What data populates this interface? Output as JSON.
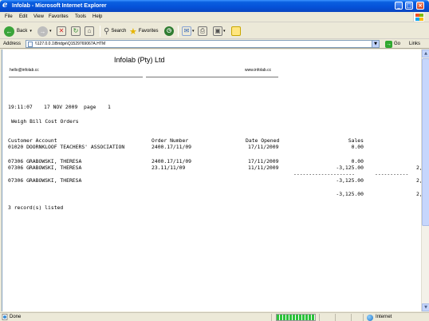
{
  "window": {
    "title": "Infolab - Microsoft Internet Explorer",
    "icon": "ie-icon",
    "controls": [
      "minimize",
      "maximize",
      "close"
    ]
  },
  "menu": {
    "items": [
      "File",
      "Edit",
      "View",
      "Favorites",
      "Tools",
      "Help"
    ]
  },
  "toolbar": {
    "back_label": "Back",
    "search_label": "Search",
    "favorites_label": "Favorites"
  },
  "address": {
    "label": "Address",
    "value": "\\\\127.0.0.1\\Bridge\\Q1529769067A.HTM",
    "go_label": "Go",
    "links_label": "Links"
  },
  "report": {
    "company": "Infolab (Pty) Ltd",
    "email": "hello@infolab.cc",
    "website": "www.infolab.cc",
    "time": "19:11:07",
    "date": "17 NOV 2009",
    "page_label": "page",
    "page_number": "1",
    "report_title": "Weigh Bill Cost Orders",
    "columns": [
      "Customer Account",
      "Order Number",
      "Date Opened",
      "Sales"
    ],
    "rows": [
      {
        "account": "01020 DOORNKLOOF TEACHERS' ASSOCIATION",
        "order": "2400.17/11/09",
        "date": "17/11/2009",
        "sales": "0.00",
        "extra": ""
      },
      {
        "account": "07306 GRABOWSKI, THERESA",
        "order": "2400.17/11/09",
        "date": "17/11/2009",
        "sales": "0.00",
        "extra": ""
      },
      {
        "account": "07306 GRABOWSKI, THERESA",
        "order": "23.11/11/09",
        "date": "11/11/2009",
        "sales": "-3,125.00",
        "extra": "2,"
      }
    ],
    "rule": "--------------------",
    "rule_extra": "-----------",
    "subtotal": {
      "account": "07306 GRABOWSKI, THERESA",
      "sales": "-3,125.00",
      "extra": "2,"
    },
    "total": {
      "sales": "-3,125.00",
      "extra": "2,"
    },
    "records_text": "3 record(s) listed"
  },
  "status": {
    "text": "Done",
    "zone": "Internet",
    "progress_fraction": 1.0
  },
  "colors": {
    "titlebar": "#0551d8",
    "chrome": "#ece9d8",
    "page": "#ffffff"
  }
}
